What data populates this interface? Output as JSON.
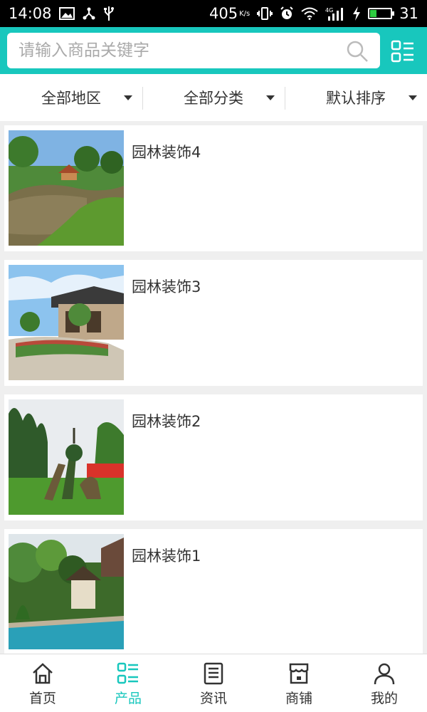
{
  "status_bar": {
    "time": "14:08",
    "speed": "405",
    "speed_unit": "K/s",
    "network": "4G",
    "battery": "31",
    "battery_level": 0.31
  },
  "search": {
    "placeholder": "请输入商品关键字",
    "value": ""
  },
  "filters": [
    {
      "label": "全部地区"
    },
    {
      "label": "全部分类"
    },
    {
      "label": "默认排序"
    }
  ],
  "products": [
    {
      "title": "园林装饰4"
    },
    {
      "title": "园林装饰3"
    },
    {
      "title": "园林装饰2"
    },
    {
      "title": "园林装饰1"
    }
  ],
  "tabs": [
    {
      "label": "首页",
      "icon": "home-icon"
    },
    {
      "label": "产品",
      "icon": "product-list-icon",
      "active": true
    },
    {
      "label": "资讯",
      "icon": "news-icon"
    },
    {
      "label": "商铺",
      "icon": "shop-icon"
    },
    {
      "label": "我的",
      "icon": "user-icon"
    }
  ],
  "colors": {
    "accent": "#18c7bd",
    "background": "#efefef",
    "text": "#333333"
  }
}
